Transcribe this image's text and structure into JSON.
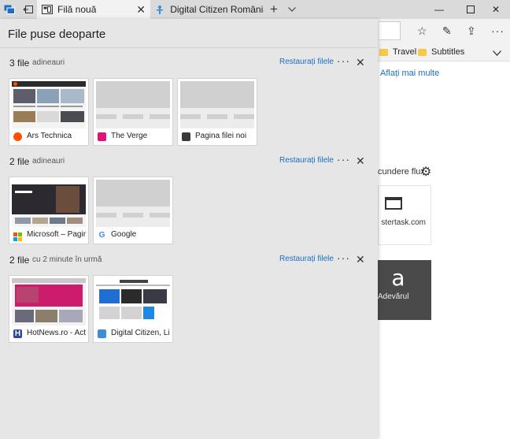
{
  "browser": {
    "tabs": [
      {
        "title": "Filă nouă",
        "active": true
      },
      {
        "title": "Digital Citizen România, Via",
        "active": false
      }
    ],
    "favorites": [
      "Travel",
      "Subtitles"
    ],
    "bg_link": "Aflați mai multe",
    "bg_feed_label": "cundere flux",
    "tiles": [
      {
        "label": "stertask.com",
        "icon": "window-icon"
      },
      {
        "label": "Adevărul",
        "letter": "a"
      }
    ]
  },
  "panel": {
    "title": "File puse deoparte",
    "groups": [
      {
        "count": "3 file",
        "time": "adineauri",
        "restore": "Restaurați filele",
        "tabs": [
          {
            "name": "Ars Technica",
            "icon": "ars-icon",
            "color": "#ff4e00"
          },
          {
            "name": "The Verge",
            "icon": "verge-icon",
            "color": "#e2127a"
          },
          {
            "name": "Pagina filei noi",
            "icon": "newtab-icon",
            "color": "#3a3a3a"
          }
        ]
      },
      {
        "count": "2 file",
        "time": "adineauri",
        "restore": "Restaurați filele",
        "tabs": [
          {
            "name": "Microsoft – Pagir",
            "icon": "microsoft-icon",
            "color": "#f25022"
          },
          {
            "name": "Google",
            "icon": "google-icon",
            "color": "#4285f4"
          }
        ]
      },
      {
        "count": "2 file",
        "time": "cu 2 minute în urmă",
        "restore": "Restaurați filele",
        "tabs": [
          {
            "name": "HotNews.ro - Act",
            "icon": "hotnews-icon",
            "color": "#2b4a9b"
          },
          {
            "name": "Digital Citizen, Li",
            "icon": "digitalcitizen-icon",
            "color": "#3a8fd8"
          }
        ]
      }
    ]
  }
}
